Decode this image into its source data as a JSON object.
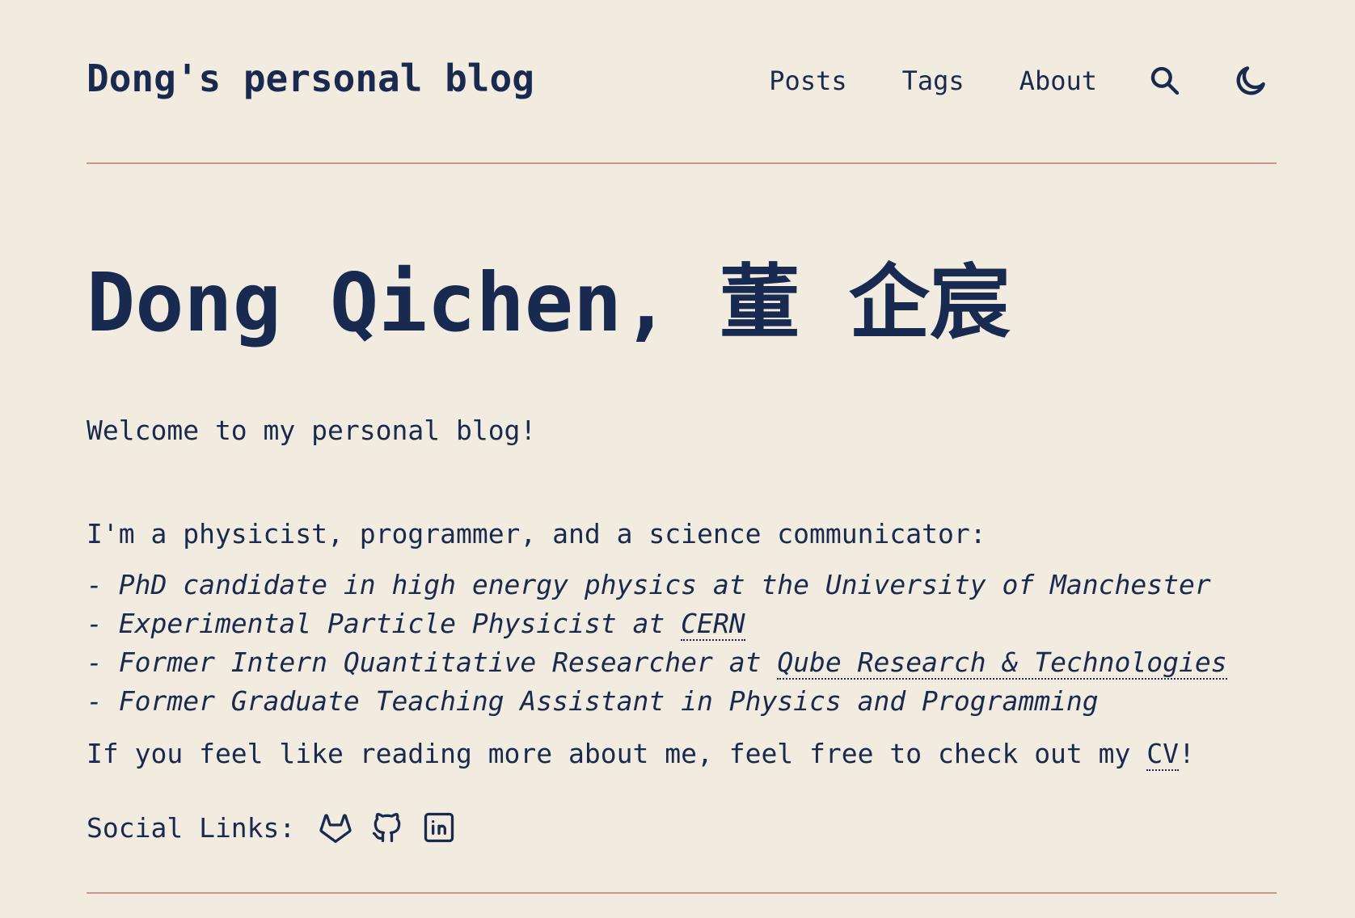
{
  "header": {
    "site_title": "Dong's personal blog",
    "nav": [
      {
        "label": "Posts"
      },
      {
        "label": "Tags"
      },
      {
        "label": "About"
      }
    ],
    "icons": [
      "search-icon",
      "moon-icon"
    ]
  },
  "main": {
    "title": "Dong Qichen, 董 企宸",
    "welcome": "Welcome to my personal blog!",
    "intro": "I'm a physicist, programmer, and a science communicator:",
    "roles": [
      {
        "prefix": "- PhD candidate in high energy physics at the University of Manchester",
        "link": "",
        "suffix": ""
      },
      {
        "prefix": "- Experimental Particle Physicist at ",
        "link": "CERN",
        "suffix": ""
      },
      {
        "prefix": "- Former Intern Quantitative Researcher at ",
        "link": "Qube Research & Technologies",
        "suffix": ""
      },
      {
        "prefix": "- Former Graduate Teaching Assistant in Physics and Programming",
        "link": "",
        "suffix": ""
      }
    ],
    "cv": {
      "prefix": "If you feel like reading more about me, feel free to check out my ",
      "link": "CV",
      "suffix": "!"
    },
    "social": {
      "label": "Social Links:",
      "icons": [
        "gitlab-icon",
        "github-icon",
        "linkedin-icon"
      ]
    }
  },
  "colors": {
    "background": "#f2ece0",
    "text": "#1a2a4f",
    "rule": "#c49a8a"
  }
}
